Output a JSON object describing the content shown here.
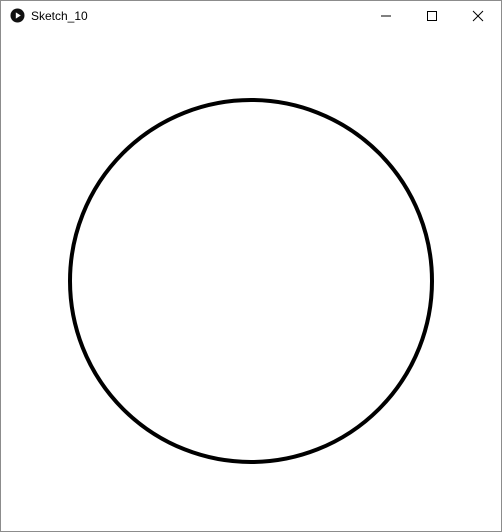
{
  "window": {
    "title": "Sketch_10",
    "icon": "processing-play-icon",
    "controls": [
      "minimize-icon",
      "maximize-icon",
      "close-icon"
    ]
  },
  "sketch": {
    "shape": "circle",
    "fill": "#ffffff",
    "stroke": "#000000"
  }
}
